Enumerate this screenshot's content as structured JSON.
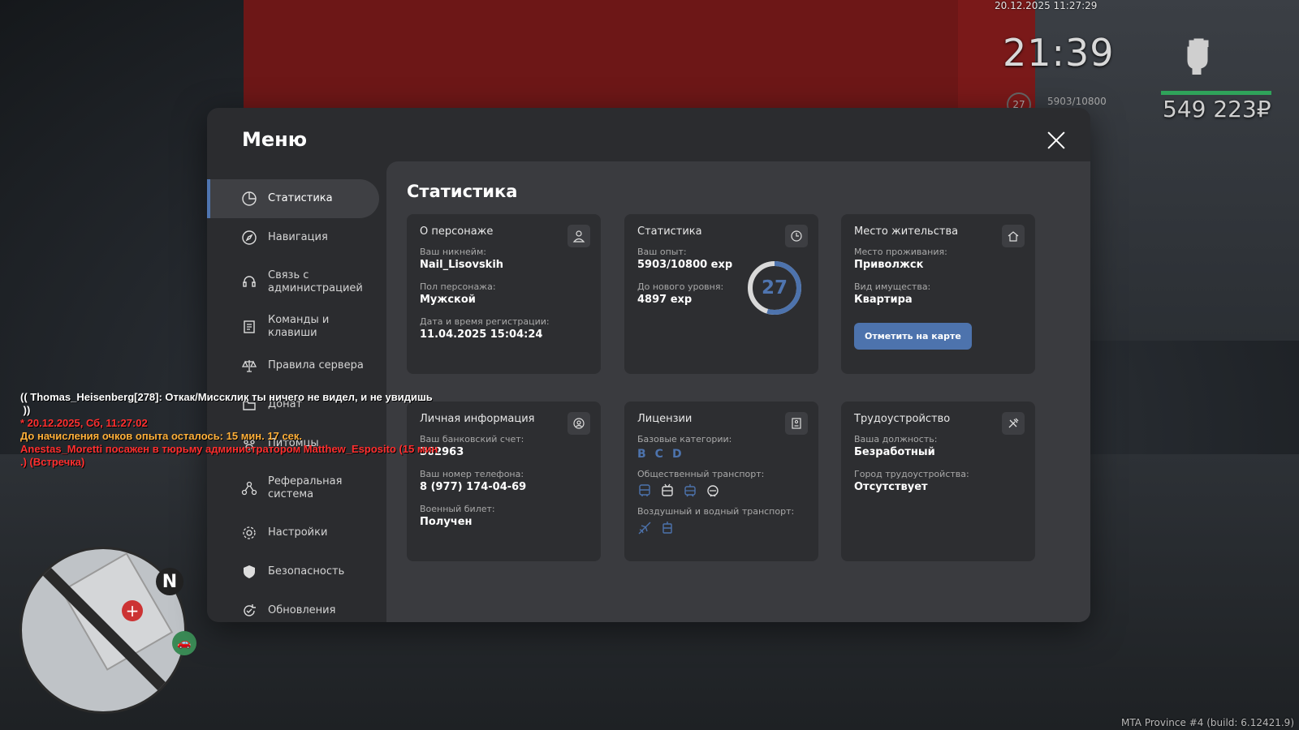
{
  "hud": {
    "datetime": "20.12.2025 11:27:29",
    "time": "21:39",
    "level": "27",
    "exp": "5903/10800",
    "money": "549 223₽",
    "build": "MTA Province #4 (build: 6.12421.9)",
    "health_fraction": 1.0,
    "health_color": "#2fa35a"
  },
  "chat": [
    {
      "text": "(( Thomas_Heisenberg[278]: Откак/Миссклик ты ничего не видел, и не увидишь",
      "color": "white"
    },
    {
      "text": " ))",
      "color": "white"
    },
    {
      "text": "* 20.12.2025, Сб, 11:27:02",
      "color": "red"
    },
    {
      "text": "До начисления очков опыта осталось: 15 мин. 17 сек.",
      "color": "orange"
    },
    {
      "text": "Anestas_Moretti посажен в тюрьму администратором Matthew_Esposito (15 мин",
      "color": "red"
    },
    {
      "text": ".) (Встречка)",
      "color": "red"
    }
  ],
  "minimap": {
    "north_label": "N"
  },
  "modal": {
    "title": "Меню",
    "close_icon": "close-icon"
  },
  "sidebar": {
    "items": [
      {
        "label": "Статистика",
        "icon": "pie-chart-icon",
        "active": true
      },
      {
        "label": "Навигация",
        "icon": "compass-icon"
      },
      {
        "label": "Связь с администрацией",
        "icon": "headset-icon"
      },
      {
        "label": "Команды и клавиши",
        "icon": "document-icon"
      },
      {
        "label": "Правила сервера",
        "icon": "scales-icon"
      },
      {
        "label": "Донат",
        "icon": "folder-icon"
      },
      {
        "label": "Питомцы",
        "icon": "paw-icon"
      },
      {
        "label": "Реферальная система",
        "icon": "network-icon"
      },
      {
        "label": "Настройки",
        "icon": "gear-icon"
      },
      {
        "label": "Безопасность",
        "icon": "shield-icon"
      },
      {
        "label": "Обновления",
        "icon": "refresh-icon"
      }
    ]
  },
  "content": {
    "title": "Статистика",
    "character": {
      "title": "О персонаже",
      "nickname_label": "Ваш никнейм:",
      "nickname": "Nail_Lisovskih",
      "gender_label": "Пол персонажа:",
      "gender": "Мужской",
      "reg_label": "Дата и время регистрации:",
      "reg_value": "11.04.2025 15:04:24"
    },
    "stats": {
      "title": "Статистика",
      "exp_label": "Ваш опыт:",
      "exp_value": "5903/10800 exp",
      "next_label": "До нового уровня:",
      "next_value": "4897 exp",
      "level": "27",
      "progress": 0.5466
    },
    "residence": {
      "title": "Место жительства",
      "place_label": "Место проживания:",
      "place": "Приволжск",
      "property_label": "Вид имущества:",
      "property": "Квартира",
      "map_button": "Отметить на карте"
    },
    "personal": {
      "title": "Личная информация",
      "bank_label": "Ваш банковский счет:",
      "bank": "362963",
      "phone_label": "Ваш номер телефона:",
      "phone": "8 (977) 174-04-69",
      "military_label": "Военный билет:",
      "military": "Получен"
    },
    "licenses": {
      "title": "Лицензии",
      "basic_label": "Базовые категории:",
      "categories": [
        "B",
        "C",
        "D"
      ],
      "public_label": "Общественный транспорт:",
      "public_icons": [
        "bus-icon",
        "trolleybus-icon",
        "tram-icon",
        "metro-icon"
      ],
      "air_label": "Воздушный и водный транспорт:",
      "air_icons": [
        "plane-icon",
        "boat-icon"
      ]
    },
    "employment": {
      "title": "Трудоустройство",
      "position_label": "Ваша должность:",
      "position": "Безработный",
      "city_label": "Город трудоустройства:",
      "city": "Отсутствует"
    }
  },
  "colors": {
    "accent": "#4d73ad",
    "modal_bg": "#2b2c2f",
    "content_bg": "#3a3b3f",
    "card_bg": "#2d2e31"
  }
}
